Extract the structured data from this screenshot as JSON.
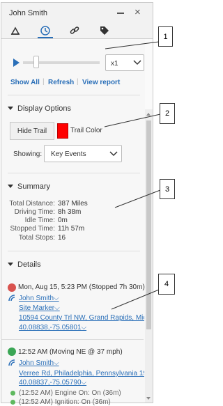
{
  "window": {
    "title": "John Smith"
  },
  "tabs": [
    {
      "icon": "vehicle-icon"
    },
    {
      "icon": "history-clock-icon",
      "active": true
    },
    {
      "icon": "link-icon"
    },
    {
      "icon": "tag-icon"
    }
  ],
  "playback": {
    "speed": "x1"
  },
  "links": {
    "show_all": "Show All",
    "refresh": "Refresh",
    "view_report": "View report",
    "separator": "|"
  },
  "display_options": {
    "heading": "Display Options",
    "hide_trail": "Hide Trail",
    "trail_color_label": "Trail Color",
    "trail_color": "#ff0000",
    "showing_label": "Showing:",
    "showing_value": "Key Events"
  },
  "summary": {
    "heading": "Summary",
    "rows": [
      {
        "label": "Total Distance:",
        "value": "387 Miles"
      },
      {
        "label": "Driving Time:",
        "value": "8h 38m"
      },
      {
        "label": "Idle Time:",
        "value": "0m"
      },
      {
        "label": "Stopped Time:",
        "value": "11h 57m"
      },
      {
        "label": "Total Stops:",
        "value": "16"
      }
    ]
  },
  "details": {
    "heading": "Details",
    "events": [
      {
        "icon": "stop-icon",
        "color": "#d9534f",
        "time": "Mon, Aug 15, 5:23 PM (Stopped 7h 30m)",
        "driver": "John Smith",
        "site": "Site Marker",
        "address": "10594 County Trl NW, Grand Rapids, Mic",
        "coords": "40.08838,-75.05801"
      },
      {
        "icon": "moving-arrow-icon",
        "color": "#3aa655",
        "time": "12:52 AM (Moving NE @ 37 mph)",
        "driver": "John Smith",
        "address": "Verree Rd, Philadelphia, Pennsylvania 19",
        "coords": "40.08837,-75.05790",
        "sub_events": [
          "(12:52 AM) Engine On: On (36m)",
          "(12:52 AM) Ignition: On (36m)"
        ]
      }
    ]
  },
  "callouts": [
    "1",
    "2",
    "3",
    "4"
  ],
  "chevron": "⌵"
}
